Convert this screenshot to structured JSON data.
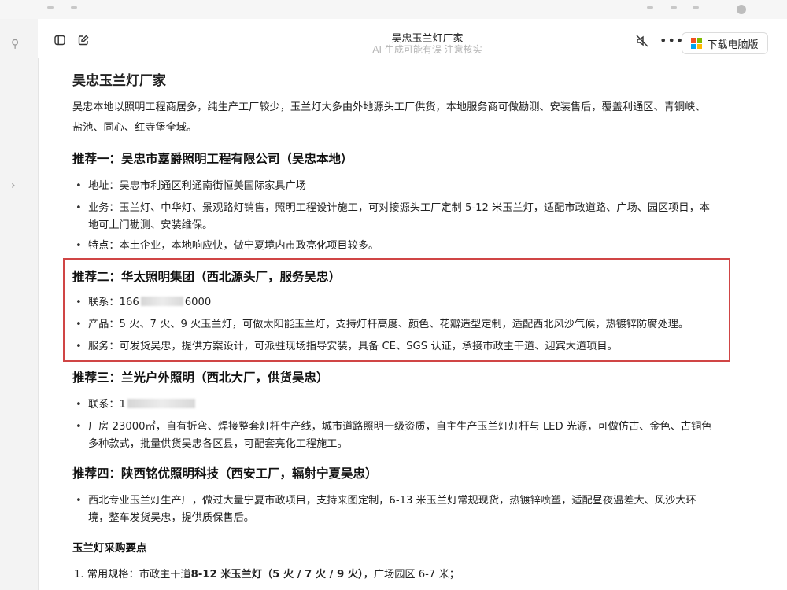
{
  "header": {
    "title": "吴忠玉兰灯厂家",
    "subtitle": "AI 生成可能有误 注意核实",
    "download_label": "下载电脑版"
  },
  "icons": {
    "sidebar_toggle": "sidebar-toggle-icon",
    "new_chat": "edit-icon",
    "mute": "speaker-mute-icon",
    "more": "more-dots-icon",
    "windows": "windows-logo-icon",
    "search": "search-icon",
    "chevron": "chevron-right-icon"
  },
  "article": {
    "title": "吴忠玉兰灯厂家",
    "intro_line1": "吴忠本地以照明工程商居多，纯生产工厂较少，玉兰灯大多由外地源头工厂供货，本地服务商可做勘测、安装售后，覆盖利通区、青铜峡、",
    "intro_line2": "盐池、同心、红寺堡全域。",
    "rec1": {
      "heading": "推荐一：吴忠市嘉爵照明工程有限公司（吴忠本地）",
      "address": "地址：吴忠市利通区利通南街恒美国际家具广场",
      "business_line1": "业务：玉兰灯、中华灯、景观路灯销售，照明工程设计施工，可对接源头工厂定制 5-12 米玉兰灯，适配市政道路、广场、园区项目，本",
      "business_line2": "地可上门勘测、安装维保。",
      "feature": "特点：本土企业，本地响应快，做宁夏境内市政亮化项目较多。"
    },
    "rec2": {
      "heading": "推荐二：华太照明集团（西北源头厂，服务吴忠）",
      "contact_prefix": "联系：166",
      "contact_suffix": "6000",
      "product": "产品：5 火、7 火、9 火玉兰灯，可做太阳能玉兰灯，支持灯杆高度、颜色、花瓣造型定制，适配西北风沙气候，热镀锌防腐处理。",
      "service": "服务：可发货吴忠，提供方案设计，可派驻现场指导安装，具备 CE、SGS 认证，承接市政主干道、迎宾大道项目。"
    },
    "rec3": {
      "heading": "推荐三：兰光户外照明（西北大厂，供货吴忠）",
      "contact_prefix": "联系：1",
      "plant_line1": "厂房 23000㎡，自有折弯、焊接整套灯杆生产线，城市道路照明一级资质，自主生产玉兰灯灯杆与 LED 光源，可做仿古、金色、古铜色",
      "plant_line2": "多种款式，批量供货吴忠各区县，可配套亮化工程施工。"
    },
    "rec4": {
      "heading": "推荐四：陕西铭优照明科技（西安工厂，辐射宁夏吴忠）",
      "line1": "西北专业玉兰灯生产厂，做过大量宁夏市政项目，支持来图定制，6-13 米玉兰灯常规现货，热镀锌喷塑，适配昼夜温差大、风沙大环",
      "line2": "境，整车发货吴忠，提供质保售后。"
    },
    "tips": {
      "heading": "玉兰灯采购要点",
      "item1_prefix": "1. 常用规格：市政主干道",
      "item1_bold": "8-12 米玉兰灯（5 火 / 7 火 / 9 火）",
      "item1_suffix": "，广场园区 6-7 米；"
    }
  },
  "colors": {
    "highlight_border": "#d04545",
    "subtitle_gray": "#b5b5b5"
  }
}
